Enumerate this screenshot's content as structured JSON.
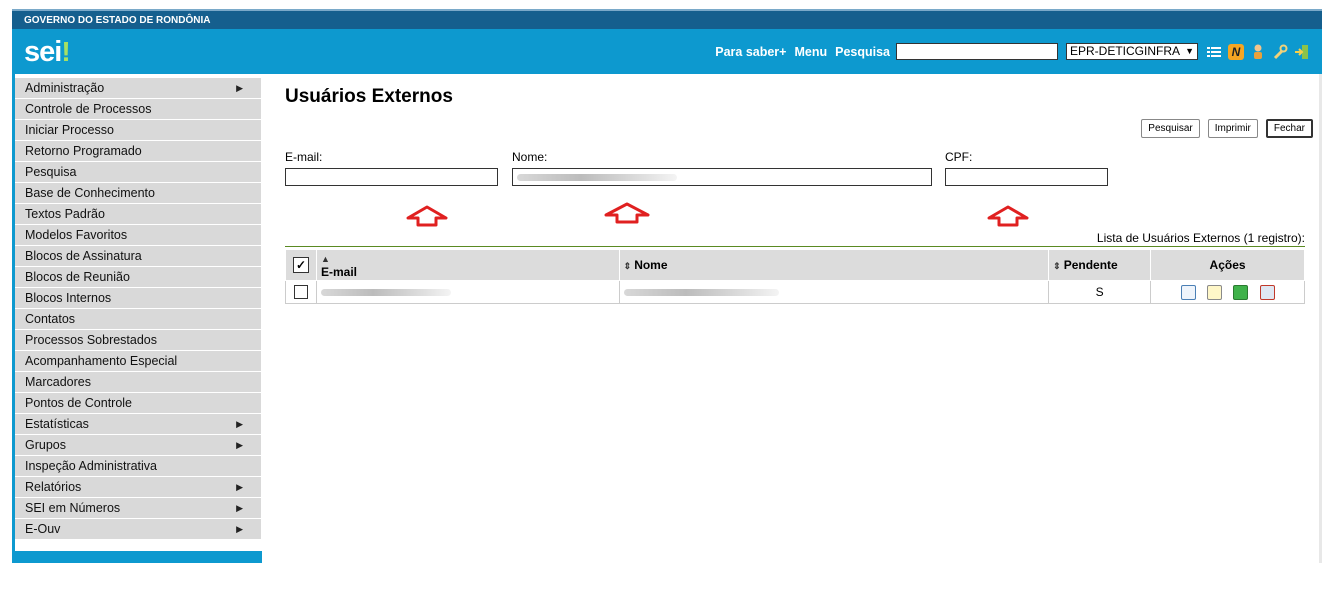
{
  "header": {
    "gov_title": "GOVERNO DO ESTADO DE RONDÔNIA",
    "logo": "sei",
    "logo_mark": "!",
    "nav": [
      "Para saber+",
      "Menu",
      "Pesquisa"
    ],
    "search_value": "",
    "unit": "EPR-DETICGINFRA",
    "icons": [
      "list-icon",
      "notepad-n-icon",
      "user-icon",
      "wrench-icon",
      "exit-icon"
    ]
  },
  "sidebar": {
    "items": [
      {
        "label": "Administração",
        "arrow": "▶"
      },
      {
        "label": "Controle de Processos",
        "arrow": ""
      },
      {
        "label": "Iniciar Processo",
        "arrow": ""
      },
      {
        "label": "Retorno Programado",
        "arrow": ""
      },
      {
        "label": "Pesquisa",
        "arrow": ""
      },
      {
        "label": "Base de Conhecimento",
        "arrow": ""
      },
      {
        "label": "Textos Padrão",
        "arrow": ""
      },
      {
        "label": "Modelos Favoritos",
        "arrow": ""
      },
      {
        "label": "Blocos de Assinatura",
        "arrow": ""
      },
      {
        "label": "Blocos de Reunião",
        "arrow": ""
      },
      {
        "label": "Blocos Internos",
        "arrow": ""
      },
      {
        "label": "Contatos",
        "arrow": ""
      },
      {
        "label": "Processos Sobrestados",
        "arrow": ""
      },
      {
        "label": "Acompanhamento Especial",
        "arrow": ""
      },
      {
        "label": "Marcadores",
        "arrow": ""
      },
      {
        "label": "Pontos de Controle",
        "arrow": ""
      },
      {
        "label": "Estatísticas",
        "arrow": "▶"
      },
      {
        "label": "Grupos",
        "arrow": "▶"
      },
      {
        "label": "Inspeção Administrativa",
        "arrow": ""
      },
      {
        "label": "Relatórios",
        "arrow": "▶"
      },
      {
        "label": "SEI em Números",
        "arrow": "▶"
      },
      {
        "label": "E-Ouv",
        "arrow": "▶"
      }
    ]
  },
  "main": {
    "title": "Usuários Externos",
    "buttons": {
      "search": "Pesquisar",
      "print": "Imprimir",
      "close": "Fechar"
    },
    "filters": {
      "email_label": "E-mail:",
      "name_label": "Nome:",
      "cpf_label": "CPF:",
      "email_value": "",
      "cpf_value": ""
    },
    "caption": "Lista de Usuários Externos (1 registro):",
    "table": {
      "headers": {
        "check": "✓",
        "email": "E-mail",
        "name": "Nome",
        "pending": "Pendente",
        "actions": "Ações"
      },
      "rows": [
        {
          "pending": "S",
          "actions": [
            "view-icon",
            "edit-icon",
            "recycle-icon",
            "delete-icon"
          ]
        }
      ]
    }
  },
  "colors": {
    "header_blue": "#0d99cf",
    "gov_bar": "#155f8e",
    "annotation_arrow": "#e02020",
    "table_accent": "#5a8a22"
  }
}
